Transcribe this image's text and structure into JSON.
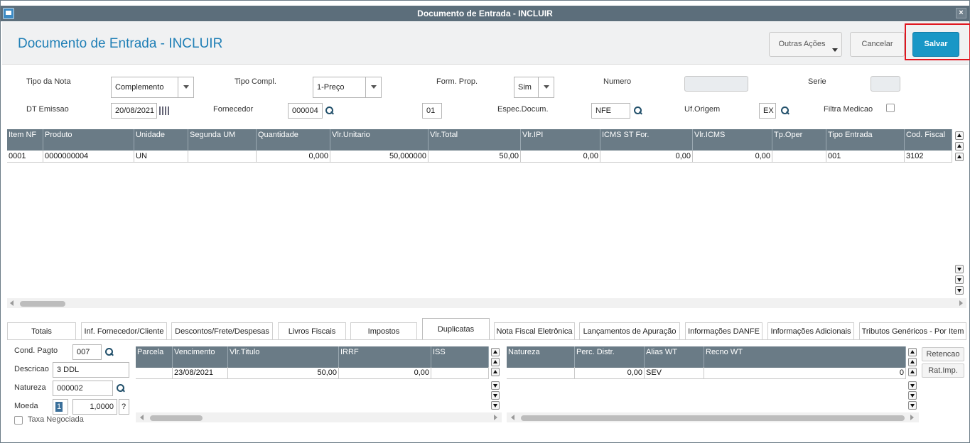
{
  "window": {
    "title": "Documento de Entrada - INCLUIR",
    "close_glyph": "×"
  },
  "header": {
    "title": "Documento de Entrada - INCLUIR",
    "btn_outras": "Outras Ações",
    "btn_cancelar": "Cancelar",
    "btn_salvar": "Salvar"
  },
  "form": {
    "tipo_nota": {
      "label": "Tipo da Nota",
      "value": "Complemento"
    },
    "tipo_compl": {
      "label": "Tipo Compl.",
      "value": "1-Preço"
    },
    "form_prop": {
      "label": "Form. Prop.",
      "value": "Sim"
    },
    "numero": {
      "label": "Numero",
      "value": ""
    },
    "serie": {
      "label": "Serie",
      "value": ""
    },
    "dt_emissao": {
      "label": "DT Emissao",
      "value": "20/08/2021"
    },
    "fornecedor": {
      "label": "Fornecedor",
      "value": "000004",
      "loja": "01"
    },
    "espec_docum": {
      "label": "Espec.Docum.",
      "value": "NFE"
    },
    "uf_origem": {
      "label": "Uf.Origem",
      "value": "EX"
    },
    "filtra_medicao": {
      "label": "Filtra Medicao",
      "checked": false
    }
  },
  "items_grid": {
    "columns": [
      "Item NF",
      "Produto",
      "Unidade",
      "Segunda UM",
      "Quantidade",
      "Vlr.Unitario",
      "Vlr.Total",
      "Vlr.IPI",
      "ICMS ST For.",
      "Vlr.ICMS",
      "Tp.Oper",
      "Tipo Entrada",
      "Cod. Fiscal"
    ],
    "rows": [
      [
        "0001",
        "0000000004",
        "UN",
        "",
        "0,000",
        "50,000000",
        "50,00",
        "0,00",
        "0,00",
        "0,00",
        "",
        "001",
        "3102"
      ]
    ]
  },
  "tabs": [
    "Totais",
    "Inf. Fornecedor/Cliente",
    "Descontos/Frete/Despesas",
    "Livros Fiscais",
    "Impostos",
    "Duplicatas",
    "Nota Fiscal Eletrônica",
    "Lançamentos de Apuração",
    "Informações DANFE",
    "Informações Adicionais",
    "Tributos Genéricos - Por Item"
  ],
  "active_tab": "Duplicatas",
  "duplicatas": {
    "cond_pagto": {
      "label": "Cond. Pagto",
      "value": "007"
    },
    "descricao": {
      "label": "Descricao",
      "value": "3 DDL"
    },
    "natureza": {
      "label": "Natureza",
      "value": "000002"
    },
    "moeda": {
      "label": "Moeda",
      "value": "1",
      "taxa": "1,0000",
      "help": "?"
    },
    "taxa_negociada": {
      "label": "Taxa Negociada",
      "checked": false
    },
    "grid": {
      "columns": [
        "Parcela",
        "Vencimento",
        "Vlr.Titulo",
        "IRRF",
        "ISS"
      ],
      "rows": [
        [
          "",
          "23/08/2021",
          "50,00",
          "0,00",
          ""
        ]
      ]
    },
    "natureza_grid": {
      "columns": [
        "Natureza",
        "Perc. Distr.",
        "Alias WT",
        "Recno WT"
      ],
      "rows": [
        [
          "",
          "0,00",
          "SEV",
          "0"
        ]
      ]
    },
    "btn_retencao": "Retencao",
    "btn_ratimp": "Rat.Imp."
  }
}
